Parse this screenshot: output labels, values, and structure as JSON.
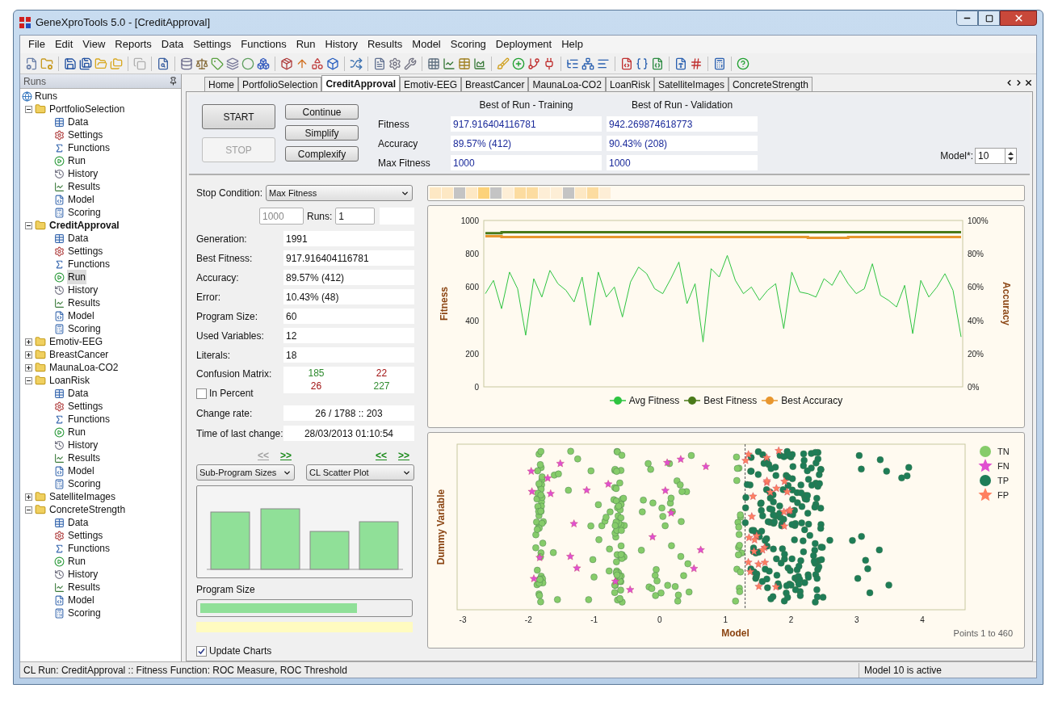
{
  "window": {
    "title": "GeneXproTools 5.0 - [CreditApproval]"
  },
  "menu": [
    "File",
    "Edit",
    "View",
    "Reports",
    "Data",
    "Settings",
    "Functions",
    "Run",
    "History",
    "Results",
    "Model",
    "Scoring",
    "Deployment",
    "Help"
  ],
  "sidebar": {
    "title": "Runs",
    "tree": {
      "label": "Runs",
      "children": [
        {
          "label": "PortfolioSelection",
          "selected": false,
          "expanded": true,
          "children": [
            {
              "label": "Data",
              "kind": "data",
              "selected": false
            },
            {
              "label": "Settings",
              "kind": "settings",
              "selected": false
            },
            {
              "label": "Functions",
              "kind": "functions",
              "selected": false
            },
            {
              "label": "Run",
              "kind": "run",
              "selected": false
            },
            {
              "label": "History",
              "kind": "history",
              "selected": false
            },
            {
              "label": "Results",
              "kind": "results",
              "selected": false
            },
            {
              "label": "Model",
              "kind": "model",
              "selected": false
            },
            {
              "label": "Scoring",
              "kind": "scoring",
              "selected": false
            }
          ]
        },
        {
          "label": "CreditApproval",
          "selected": true,
          "expanded": true,
          "children": [
            {
              "label": "Data",
              "kind": "data",
              "selected": false
            },
            {
              "label": "Settings",
              "kind": "settings",
              "selected": false
            },
            {
              "label": "Functions",
              "kind": "functions",
              "selected": false
            },
            {
              "label": "Run",
              "kind": "run",
              "selected": true
            },
            {
              "label": "History",
              "kind": "history",
              "selected": false
            },
            {
              "label": "Results",
              "kind": "results",
              "selected": false
            },
            {
              "label": "Model",
              "kind": "model",
              "selected": false
            },
            {
              "label": "Scoring",
              "kind": "scoring",
              "selected": false
            }
          ]
        },
        {
          "label": "Emotiv-EEG",
          "selected": false,
          "expanded": false
        },
        {
          "label": "BreastCancer",
          "selected": false,
          "expanded": false
        },
        {
          "label": "MaunaLoa-CO2",
          "selected": false,
          "expanded": false
        },
        {
          "label": "LoanRisk",
          "selected": false,
          "expanded": true,
          "children": [
            {
              "label": "Data",
              "kind": "data",
              "selected": false
            },
            {
              "label": "Settings",
              "kind": "settings",
              "selected": false
            },
            {
              "label": "Functions",
              "kind": "functions",
              "selected": false
            },
            {
              "label": "Run",
              "kind": "run",
              "selected": false
            },
            {
              "label": "History",
              "kind": "history",
              "selected": false
            },
            {
              "label": "Results",
              "kind": "results",
              "selected": false
            },
            {
              "label": "Model",
              "kind": "model",
              "selected": false
            },
            {
              "label": "Scoring",
              "kind": "scoring",
              "selected": false
            }
          ]
        },
        {
          "label": "SatelliteImages",
          "selected": false,
          "expanded": false
        },
        {
          "label": "ConcreteStrength",
          "selected": false,
          "expanded": true,
          "children": [
            {
              "label": "Data",
              "kind": "data",
              "selected": false
            },
            {
              "label": "Settings",
              "kind": "settings",
              "selected": false
            },
            {
              "label": "Functions",
              "kind": "functions",
              "selected": false
            },
            {
              "label": "Run",
              "kind": "run",
              "selected": false
            },
            {
              "label": "History",
              "kind": "history",
              "selected": false
            },
            {
              "label": "Results",
              "kind": "results",
              "selected": false
            },
            {
              "label": "Model",
              "kind": "model",
              "selected": false
            },
            {
              "label": "Scoring",
              "kind": "scoring",
              "selected": false
            }
          ]
        }
      ]
    }
  },
  "tabs": [
    {
      "label": "Home",
      "selected": false
    },
    {
      "label": "PortfolioSelection",
      "selected": false
    },
    {
      "label": "CreditApproval",
      "selected": true
    },
    {
      "label": "Emotiv-EEG",
      "selected": false
    },
    {
      "label": "BreastCancer",
      "selected": false
    },
    {
      "label": "MaunaLoa-CO2",
      "selected": false
    },
    {
      "label": "LoanRisk",
      "selected": false
    },
    {
      "label": "SatelliteImages",
      "selected": false
    },
    {
      "label": "ConcreteStrength",
      "selected": false
    }
  ],
  "run_panel": {
    "buttons": [
      {
        "label": "START",
        "disabled": false
      },
      {
        "label": "STOP",
        "disabled": true
      }
    ],
    "actions": [
      "Continue",
      "Simplify",
      "Complexify"
    ],
    "columns": [
      "Best of Run - Training",
      "Best of Run - Validation"
    ],
    "rows": [
      {
        "label": "Fitness",
        "values": [
          "917.916404116781",
          "942.269874618773"
        ]
      },
      {
        "label": "Accuracy",
        "values": [
          "89.57% (412)",
          "90.43% (208)"
        ]
      },
      {
        "label": "Max Fitness",
        "values": [
          "1000",
          "1000"
        ]
      }
    ],
    "model": {
      "label": "Model*:",
      "value": "10"
    }
  },
  "stop_condition": {
    "label": "Stop Condition:",
    "value": "Max Fitness",
    "max_value": "1000",
    "runs_label": "Runs:",
    "runs": "1"
  },
  "stats": [
    {
      "label": "Generation:",
      "value": "1991"
    },
    {
      "label": "Best Fitness:",
      "value": "917.916404116781"
    },
    {
      "label": "Accuracy:",
      "value": "89.57% (412)"
    },
    {
      "label": "Error:",
      "value": "10.43% (48)"
    },
    {
      "label": "Program Size:",
      "value": "60"
    },
    {
      "label": "Used Variables:",
      "value": "12"
    },
    {
      "label": "Literals:",
      "value": "18"
    }
  ],
  "confusion_matrix": {
    "label": "Confusion Matrix:",
    "cells": [
      {
        "value": "185",
        "color": "#2e8b2e"
      },
      {
        "value": "22",
        "color": "#a01010"
      },
      {
        "value": "26",
        "color": "#a01010"
      },
      {
        "value": "227",
        "color": "#2e8b2e"
      }
    ],
    "percent": {
      "label": "In Percent",
      "checked": false
    }
  },
  "change_rate": {
    "label": "Change rate:",
    "value": "26 / 1788 :: 203"
  },
  "last_change": {
    "label": "Time of last change:",
    "value": "28/03/2013 01:10:54"
  },
  "nav": [
    {
      "label": "<<",
      "disabled": true
    },
    {
      "label": ">>",
      "disabled": false
    },
    {
      "label": "<<",
      "disabled": false
    },
    {
      "label": ">>",
      "disabled": false
    }
  ],
  "chart_selectors": [
    "Sub-Program Sizes",
    "CL Scatter Plot"
  ],
  "program_size": {
    "label": "Program Size",
    "level": 0.75
  },
  "update_charts": {
    "label": "Update Charts",
    "checked": true
  },
  "color_strip": [
    {
      "color": "#fde8c4"
    },
    {
      "color": "#fde8c4"
    },
    {
      "color": "#c4c4c4"
    },
    {
      "color": "#fde8c4"
    },
    {
      "color": "#fcd27a"
    },
    {
      "color": "#c4c4c4"
    },
    {
      "color": "#fdeed6"
    },
    {
      "color": "#fcdca0"
    },
    {
      "color": "#fcdca0"
    },
    {
      "color": "#fdeed6"
    },
    {
      "color": "#fdeed6"
    },
    {
      "color": "#c4c4c4"
    },
    {
      "color": "#fde8c4"
    },
    {
      "color": "#fcdca0"
    },
    {
      "color": "#fdeed6"
    }
  ],
  "fitness_chart": {
    "right_label": "Accuracy",
    "right_ticks": [
      "100%",
      "80%",
      "60%",
      "40%",
      "20%",
      "0%"
    ],
    "chart_data": {
      "type": "line",
      "ylabel": "Fitness",
      "ylim": [
        0,
        1000
      ],
      "yticks": [
        0,
        200,
        400,
        600,
        800,
        1000
      ],
      "series": [
        {
          "name": "Avg Fitness",
          "color": "#2ec440",
          "values": [
            560,
            640,
            470,
            690,
            590,
            310,
            650,
            540,
            700,
            620,
            580,
            510,
            660,
            370,
            690,
            540,
            600,
            420,
            630,
            720,
            680,
            590,
            560,
            650,
            750,
            500,
            620,
            270,
            710,
            660,
            790,
            640,
            560,
            600,
            520,
            580,
            620,
            350,
            690,
            570,
            560,
            540,
            650,
            610,
            700,
            620,
            560,
            590,
            740,
            550,
            520,
            480,
            610,
            320,
            640,
            540,
            600,
            680,
            580,
            300
          ]
        },
        {
          "name": "Best Fitness",
          "color": "#4a7a1a",
          "values": [
            924,
            924,
            930,
            930,
            930,
            930,
            930,
            930,
            930,
            930,
            930,
            930,
            930,
            930,
            930,
            930,
            930,
            930,
            930,
            930,
            930,
            930,
            930,
            930,
            930,
            930,
            930,
            930,
            930,
            930,
            930,
            930,
            930,
            930,
            930,
            930,
            930,
            930,
            930,
            930,
            930,
            930,
            930,
            930,
            930,
            930,
            930,
            930,
            930,
            930,
            930,
            930,
            930,
            930,
            930,
            930,
            930,
            930,
            930,
            930
          ]
        },
        {
          "name": "Best Accuracy",
          "color": "#e8962e",
          "values": [
            905,
            905,
            900,
            900,
            900,
            900,
            900,
            900,
            900,
            900,
            900,
            900,
            900,
            900,
            900,
            900,
            900,
            900,
            900,
            900,
            900,
            900,
            900,
            900,
            900,
            900,
            900,
            900,
            900,
            900,
            900,
            900,
            900,
            900,
            900,
            900,
            900,
            900,
            900,
            900,
            895,
            895,
            895,
            895,
            895,
            900,
            900,
            900,
            900,
            900,
            900,
            900,
            900,
            900,
            900,
            900,
            900,
            900,
            900,
            900
          ]
        }
      ]
    }
  },
  "scatter": {
    "xlabel": "Model",
    "ylabel": "Dummy Variable",
    "xticks": [
      "-3",
      "-2",
      "-1",
      "0",
      "1",
      "2",
      "3",
      "4"
    ],
    "footer": "Points 1 to 460",
    "legend": [
      {
        "label": "TN",
        "kind": "circle",
        "color": "#86cc6a"
      },
      {
        "label": "FN",
        "kind": "star",
        "color": "#e050d0"
      },
      {
        "label": "TP",
        "kind": "circle",
        "color": "#1e7d57"
      },
      {
        "label": "FP",
        "kind": "star",
        "color": "#ff8060"
      }
    ]
  },
  "status_bar": [
    "CL Run: CreditApproval :: Fitness Function: ROC Measure, ROC Threshold",
    "Model 10 is active"
  ]
}
